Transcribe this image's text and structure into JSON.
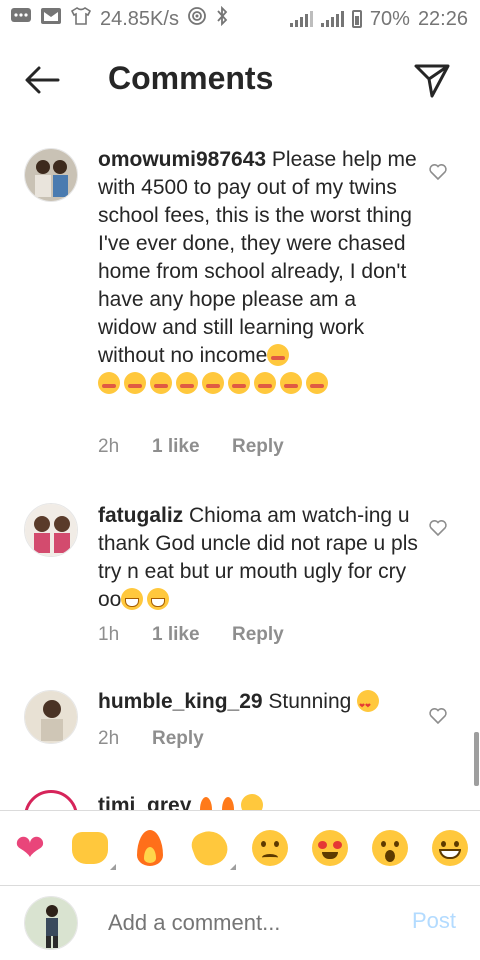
{
  "status_bar": {
    "net_speed": "24.85K/s",
    "battery": "70%",
    "time": "22:26",
    "icons": [
      "chat-icon",
      "mail-icon",
      "shirt-icon",
      "hotspot-icon",
      "bluetooth-icon",
      "signal-icon",
      "signal-h-icon",
      "battery-icon"
    ]
  },
  "header": {
    "title": "Comments",
    "back_icon": "arrow-left-icon",
    "send_icon": "paper-plane-icon"
  },
  "comments": [
    {
      "username": "omowumi987643",
      "text": "Please help me with 4500 to pay out of my twins school fees, this is the worst thing I've ever done, they were chased home from school already, I don't have any hope please am a widow and still learning work without no income",
      "emoji_count": 10,
      "time": "2h",
      "likes": "1 like",
      "reply": "Reply"
    },
    {
      "username": "fatugaliz",
      "text": "Chioma am watch-ing u thank God uncle did not rape u pls try n eat but ur mouth ugly for cry oo",
      "emoji_count": 2,
      "time": "1h",
      "likes": "1 like",
      "reply": "Reply"
    },
    {
      "username": "humble_king_29",
      "text": "Stunning",
      "time": "2h",
      "reply": "Reply"
    },
    {
      "username": "timi_grey"
    }
  ],
  "emoji_bar": [
    "heart",
    "raised-hands",
    "fire",
    "clapping-hands",
    "confused-face",
    "heart-eyes-face",
    "surprised-face",
    "grinning-face"
  ],
  "composer": {
    "placeholder": "Add a comment...",
    "post_label": "Post"
  }
}
